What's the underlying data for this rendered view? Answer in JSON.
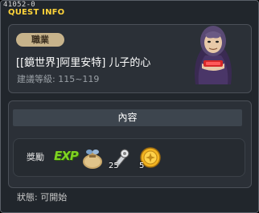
{
  "window": {
    "quest_id": "41052-0",
    "title": "QUEST INFO"
  },
  "quest": {
    "job_badge": "職業",
    "name": "[[鏡世界]阿里安特] 儿子的心",
    "level_label": "建議等級:",
    "level_range": "115~119"
  },
  "content": {
    "header": "內容",
    "reward_label": "獎勵",
    "rewards": [
      {
        "icon": "exp-icon",
        "label": "EXP"
      },
      {
        "icon": "money-bag-icon"
      },
      {
        "icon": "tool-item-icon",
        "count": "25"
      },
      {
        "icon": "gold-coin-icon",
        "count": "5"
      }
    ]
  },
  "status": {
    "label": "狀態:",
    "value": "可開始"
  },
  "colors": {
    "title": "#ffd43a",
    "exp": "#7ed321",
    "badge_bg": "#c7b38b"
  }
}
